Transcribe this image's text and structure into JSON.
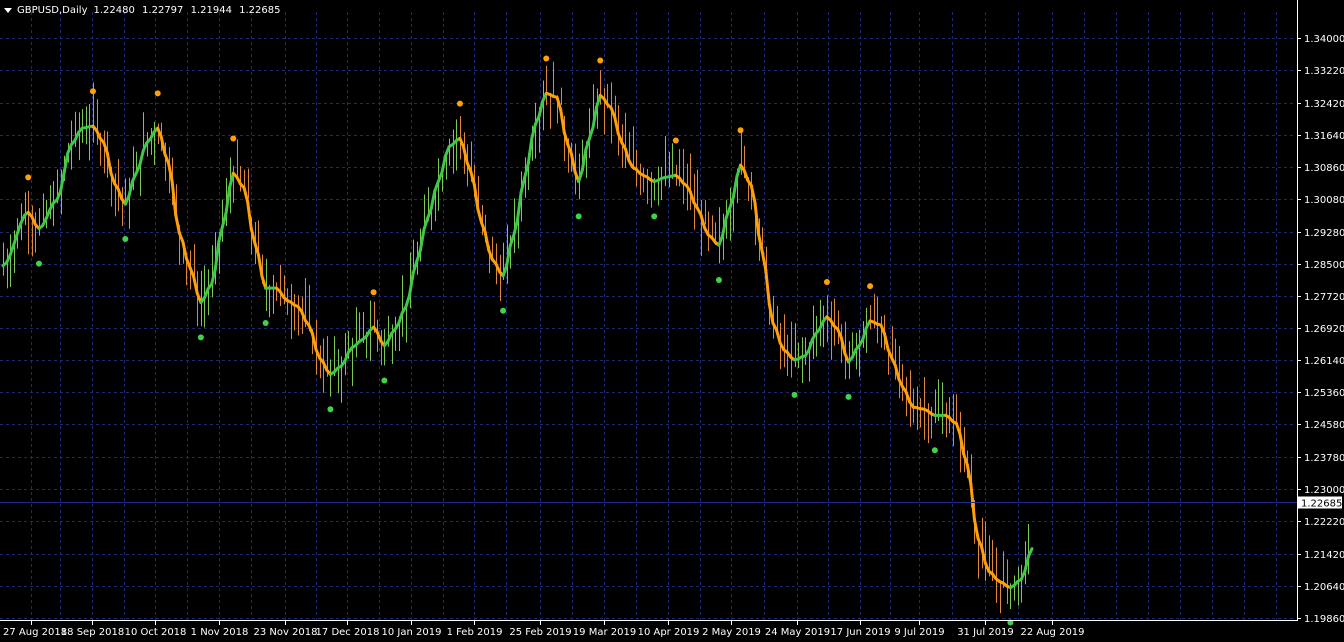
{
  "header": {
    "symbol": "GBPUSD,Daily",
    "open": "1.22480",
    "high": "1.22797",
    "low": "1.21944",
    "close": "1.22685"
  },
  "colors": {
    "background": "#000000",
    "grid": "#1e2a6e",
    "axis": "#ffffff",
    "bull": "#7ec850",
    "bear": "#e0883a",
    "ma_up": "#3fc84a",
    "ma_down": "#ffa00a",
    "dot_up": "#3fd34a",
    "dot_down": "#ffa00a",
    "price_line": "#1e2a8e",
    "price_label_bg": "#ffffff",
    "price_label_text": "#000000"
  },
  "chart_data": {
    "type": "line",
    "ylim": [
      1.1986,
      1.3434
    ],
    "y_ticks": [
      "1.34000",
      "1.33220",
      "1.32420",
      "1.31640",
      "1.30860",
      "1.30080",
      "1.29280",
      "1.28500",
      "1.27720",
      "1.26920",
      "1.26140",
      "1.25360",
      "1.24580",
      "1.23780",
      "1.23000",
      "1.22220",
      "1.21420",
      "1.20640",
      "1.19860"
    ],
    "x_ticks": [
      "27 Aug 2018",
      "18 Sep 2018",
      "10 Oct 2018",
      "1 Nov 2018",
      "23 Nov 2018",
      "17 Dec 2018",
      "10 Jan 2019",
      "1 Feb 2019",
      "25 Feb 2019",
      "19 Mar 2019",
      "10 Apr 2019",
      "2 May 2019",
      "24 May 2019",
      "17 Jun 2019",
      "9 Jul 2019",
      "31 Jul 2019",
      "22 Aug 2019"
    ],
    "current_price": "1.22685",
    "grid": true,
    "series": [
      {
        "kind": "ma-line",
        "x_index": [
          0,
          7,
          10,
          15,
          19,
          22,
          25,
          28,
          31,
          34,
          37,
          40,
          43,
          46,
          49,
          52,
          55,
          58,
          61,
          64,
          67,
          70,
          73,
          76,
          79,
          82,
          85,
          88,
          91,
          94,
          97,
          100,
          103,
          106,
          109,
          112,
          115,
          118,
          121,
          124,
          127,
          130,
          133,
          136,
          139,
          142,
          145,
          148,
          151,
          154,
          157,
          160,
          163,
          166,
          169,
          172,
          175,
          178,
          181,
          184,
          187,
          190,
          193,
          196,
          199,
          202,
          205,
          208,
          211,
          214,
          217,
          220,
          223,
          226,
          229,
          232,
          235,
          238,
          241,
          244,
          247,
          250,
          253,
          256,
          259,
          262,
          265,
          268,
          271,
          274,
          277,
          280,
          283,
          286
        ],
        "values": [
          1.2845,
          1.2975,
          1.2935,
          1.3005,
          1.314,
          1.318,
          1.3185,
          1.3145,
          1.3045,
          1.2995,
          1.307,
          1.3145,
          1.318,
          1.3095,
          1.2925,
          1.284,
          1.2755,
          1.28,
          1.294,
          1.307,
          1.3035,
          1.29,
          1.279,
          1.279,
          1.276,
          1.2745,
          1.27,
          1.262,
          1.258,
          1.26,
          1.2645,
          1.2665,
          1.2695,
          1.265,
          1.269,
          1.2745,
          1.2855,
          1.296,
          1.305,
          1.3135,
          1.3155,
          1.3075,
          1.295,
          1.286,
          1.282,
          1.292,
          1.306,
          1.319,
          1.3265,
          1.3255,
          1.314,
          1.305,
          1.3155,
          1.326,
          1.323,
          1.3145,
          1.3085,
          1.3065,
          1.305,
          1.306,
          1.3065,
          1.304,
          1.2985,
          1.292,
          1.2895,
          1.2985,
          1.309,
          1.304,
          1.288,
          1.2705,
          1.264,
          1.2615,
          1.2625,
          1.268,
          1.272,
          1.269,
          1.261,
          1.265,
          1.271,
          1.27,
          1.262,
          1.255,
          1.25,
          1.2495,
          1.248,
          1.248,
          1.246,
          1.236,
          1.218,
          1.21,
          1.2075,
          1.206,
          1.208,
          1.2155
        ]
      }
    ]
  }
}
